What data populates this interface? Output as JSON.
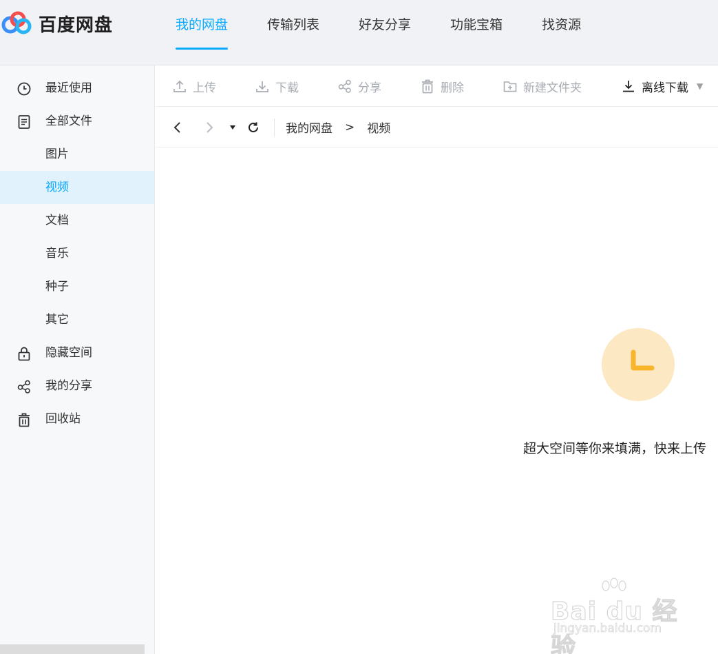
{
  "app": {
    "title": "百度网盘"
  },
  "topnav": {
    "items": [
      {
        "label": "我的网盘",
        "active": true
      },
      {
        "label": "传输列表",
        "active": false
      },
      {
        "label": "好友分享",
        "active": false
      },
      {
        "label": "功能宝箱",
        "active": false
      },
      {
        "label": "找资源",
        "active": false
      }
    ]
  },
  "sidebar": {
    "items": [
      {
        "label": "最近使用",
        "icon": "clock-icon"
      },
      {
        "label": "全部文件",
        "icon": "document-icon"
      },
      {
        "label": "图片",
        "icon": ""
      },
      {
        "label": "视频",
        "icon": "",
        "selected": true
      },
      {
        "label": "文档",
        "icon": ""
      },
      {
        "label": "音乐",
        "icon": ""
      },
      {
        "label": "种子",
        "icon": ""
      },
      {
        "label": "其它",
        "icon": ""
      },
      {
        "label": "隐藏空间",
        "icon": "lock-icon"
      },
      {
        "label": "我的分享",
        "icon": "share-icon"
      },
      {
        "label": "回收站",
        "icon": "trash-icon"
      }
    ]
  },
  "toolbar": {
    "upload": "上传",
    "download": "下载",
    "share": "分享",
    "delete": "删除",
    "new_folder": "新建文件夹",
    "offline_download": "离线下载"
  },
  "breadcrumb": {
    "root": "我的网盘",
    "separator": ">",
    "current": "视频"
  },
  "empty_state": {
    "message": "超大空间等你来填满，快来上传"
  },
  "watermark": {
    "brand": "Bai du 经验",
    "url": "jingyan.baidu.com"
  },
  "colors": {
    "accent": "#09aaff",
    "empty_icon_bg": "#fde8c4",
    "empty_icon_fg": "#f8b52c"
  }
}
